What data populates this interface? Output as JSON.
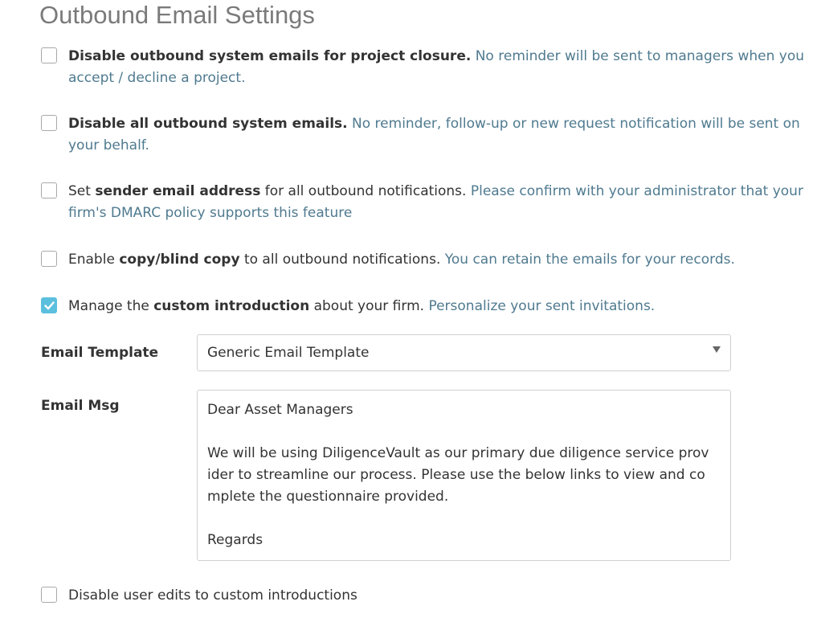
{
  "page": {
    "title": "Outbound Email Settings"
  },
  "options": [
    {
      "checked": false,
      "prefix": "",
      "bold": "Disable outbound system emails for project closure.",
      "suffix": " ",
      "hint": "No reminder will be sent to managers when you accept / decline a project."
    },
    {
      "checked": false,
      "prefix": "",
      "bold": "Disable all outbound system emails.",
      "suffix": " ",
      "hint": "No reminder, follow-up or new request notification will be sent on your behalf."
    },
    {
      "checked": false,
      "prefix": "Set ",
      "bold": "sender email address",
      "suffix": " for all outbound notifications. ",
      "hint": "Please confirm with your administrator that your firm's DMARC policy supports this feature"
    },
    {
      "checked": false,
      "prefix": "Enable ",
      "bold": "copy/blind copy",
      "suffix": " to all outbound notifications. ",
      "hint": "You can retain the emails for your records."
    },
    {
      "checked": true,
      "prefix": "Manage the ",
      "bold": "custom introduction",
      "suffix": " about your firm. ",
      "hint": "Personalize your sent invitations."
    }
  ],
  "template_field": {
    "label": "Email Template",
    "selected": "Generic Email Template"
  },
  "message_field": {
    "label": "Email Msg",
    "lines": [
      "Dear Asset Managers",
      "",
      "We will be using DiligenceVault as our primary due diligence service prov",
      "ider to streamline our process. Please use the below links to view and co",
      "mplete the questionnaire provided.",
      "",
      "Regards"
    ]
  },
  "final_option": {
    "checked": false,
    "label": "Disable user edits to custom introductions"
  },
  "colors": {
    "hint_text": "#4f7a8f",
    "checkbox_checked": "#5bc0de",
    "title_text": "#7a7a7a"
  }
}
